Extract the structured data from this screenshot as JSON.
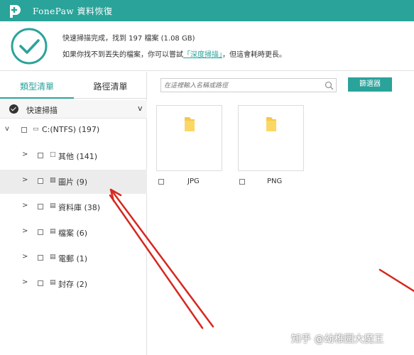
{
  "titlebar": {
    "app_name": "FonePaw 資料恢復",
    "bg_color": "#2aa39a",
    "logo_icon": "fonepaw-logo-icon"
  },
  "status": {
    "line1": "快速掃描完成，找到 197 檔案 (1.08 GB)",
    "line2_prefix": "如果你找不到丟失的檔案，你可以嘗試",
    "deep_scan_link": "「深度掃描」",
    "line2_suffix": "，但這會耗時更長。",
    "check_icon": "check-circle-icon"
  },
  "tabs": {
    "type_list": "類型清單",
    "path_list": "路徑清單"
  },
  "quick_scan": {
    "label": "快速掃描",
    "chevron": "v"
  },
  "tree": {
    "drive": {
      "label": "C:(NTFS) (197)",
      "toggle": "v"
    },
    "items": [
      {
        "label": "其他 (141)",
        "toggle": ">",
        "icon": "□"
      },
      {
        "label": "圖片 (9)",
        "toggle": ">",
        "icon": "▨"
      },
      {
        "label": "資料庫 (38)",
        "toggle": ">",
        "icon": "▤"
      },
      {
        "label": "檔案 (6)",
        "toggle": ">",
        "icon": "▤"
      },
      {
        "label": "電郵 (1)",
        "toggle": ">",
        "icon": "▤"
      },
      {
        "label": "封存 (2)",
        "toggle": ">",
        "icon": "▤"
      }
    ]
  },
  "search": {
    "placeholder": "在這裡輸入名稱或路徑"
  },
  "filter_button": "篩選器",
  "files": [
    {
      "label": "JPG"
    },
    {
      "label": "PNG"
    }
  ],
  "watermark": "知乎 @幼稚园大魔王",
  "colors": {
    "accent": "#2aa39a",
    "arrow": "#d6281f"
  }
}
